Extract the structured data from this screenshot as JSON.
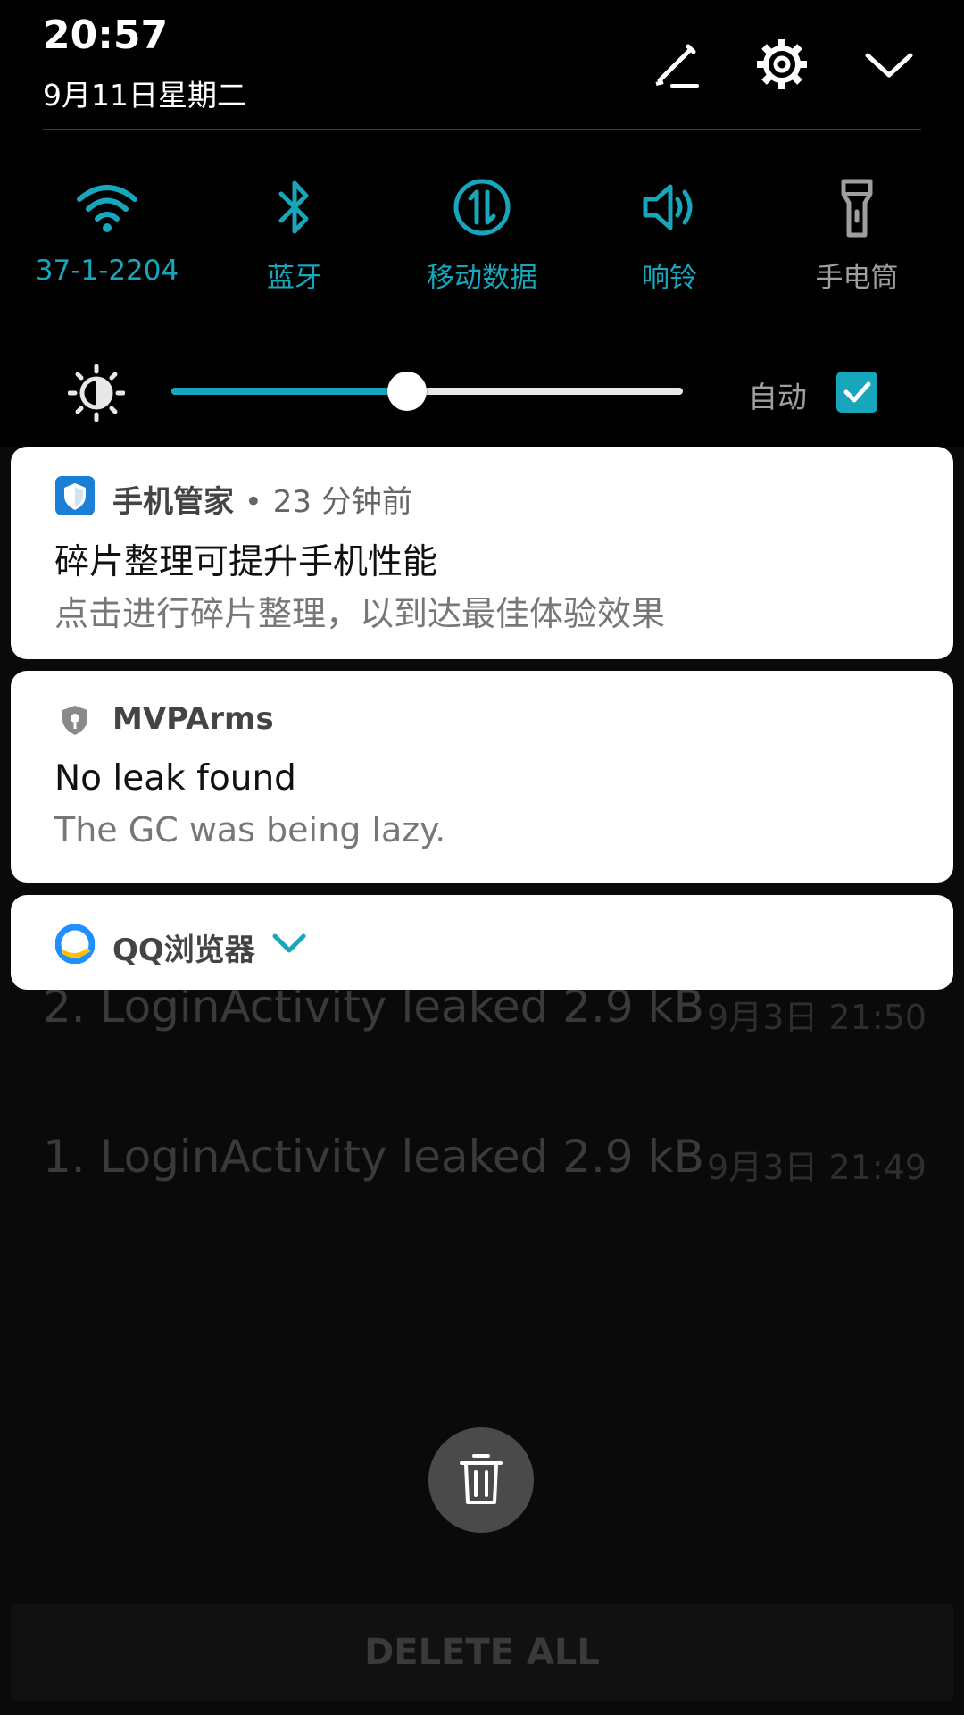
{
  "status": {
    "time": "20:57",
    "date": "9月11日星期二"
  },
  "header_icons": [
    "edit-icon",
    "gear-icon",
    "chevron-down-icon"
  ],
  "tiles": [
    {
      "label": "37-1-2204",
      "icon": "wifi-icon",
      "active": true
    },
    {
      "label": "蓝牙",
      "icon": "bluetooth-icon",
      "active": true
    },
    {
      "label": "移动数据",
      "icon": "mobile-data-icon",
      "active": true
    },
    {
      "label": "响铃",
      "icon": "speaker-icon",
      "active": true
    },
    {
      "label": "手电筒",
      "icon": "flashlight-icon",
      "active": false
    }
  ],
  "brightness": {
    "level_percent": 46,
    "auto_label": "自动",
    "auto_checked": true
  },
  "notifications": [
    {
      "app": "手机管家",
      "separator": "•",
      "time": "23 分钟前",
      "title": "碎片整理可提升手机性能",
      "text": "点击进行碎片整理，以到达最佳体验效果",
      "icon": "shield-icon"
    },
    {
      "app": "MVPArms",
      "title": "No leak found",
      "text": "The GC was being lazy.",
      "icon": "leakcanary-icon"
    },
    {
      "app": "QQ浏览器",
      "icon": "qq-browser-icon",
      "collapsed": true
    }
  ],
  "background_list": [
    {
      "text": "2. LoginActivity leaked 2.9 kB",
      "time": "9月3日 21:50"
    },
    {
      "text": "1. LoginActivity leaked 2.9 kB",
      "time": "9月3日 21:49"
    }
  ],
  "delete_all_label": "DELETE ALL",
  "colors": {
    "accent": "#17a6bb",
    "shade": "#000000",
    "card": "#ffffff"
  }
}
